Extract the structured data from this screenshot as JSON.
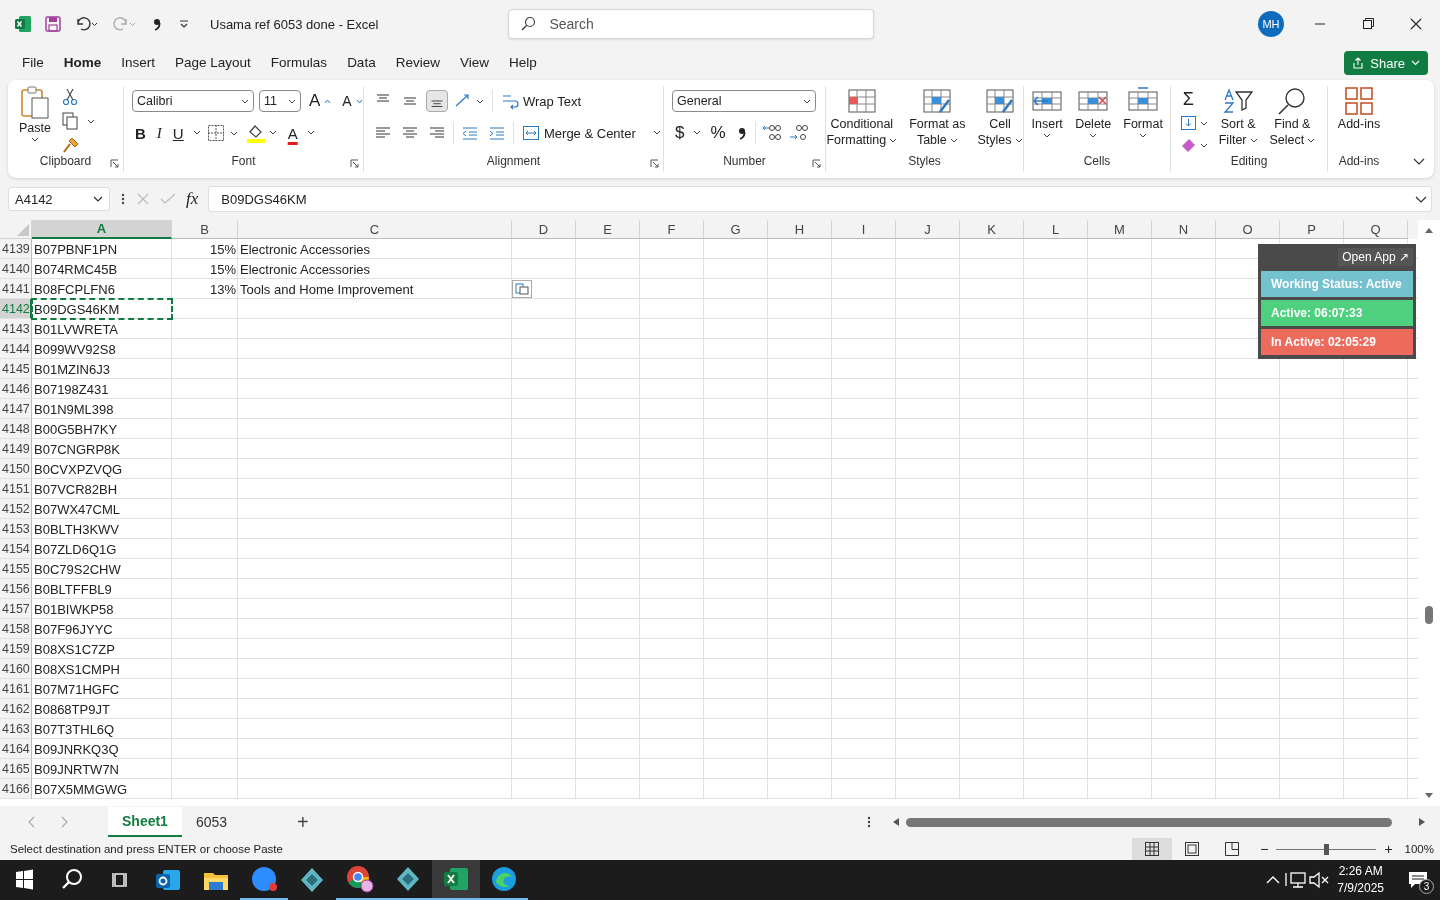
{
  "title_bar": {
    "title": "Usama ref 6053 done - Excel",
    "search": {
      "placeholder": "Search"
    },
    "avatar": "MH"
  },
  "menu_tabs": [
    {
      "label": "File",
      "selected": false
    },
    {
      "label": "Home",
      "selected": true
    },
    {
      "label": "Insert",
      "selected": false
    },
    {
      "label": "Page Layout",
      "selected": false
    },
    {
      "label": "Formulas",
      "selected": false
    },
    {
      "label": "Data",
      "selected": false
    },
    {
      "label": "Review",
      "selected": false
    },
    {
      "label": "View",
      "selected": false
    },
    {
      "label": "Help",
      "selected": false
    }
  ],
  "share_button": "Share",
  "ribbon": {
    "clipboard": {
      "label": "Clipboard",
      "paste": "Paste"
    },
    "font": {
      "label": "Font",
      "family": "Calibri",
      "size": "11",
      "grow": "A",
      "shrink": "A",
      "bold": "B",
      "italic": "I",
      "underline": "U",
      "font_color": "A"
    },
    "alignment": {
      "label": "Alignment",
      "vertical": [
        {
          "selected": false
        },
        {
          "selected": false
        },
        {
          "selected": true
        }
      ],
      "wrap_text": "Wrap Text",
      "merge": "Merge & Center"
    },
    "number": {
      "label": "Number",
      "format": "General",
      "currency": "$",
      "percent": "%"
    },
    "styles": {
      "label": "Styles",
      "buttons": [
        {
          "lines": [
            "Conditional",
            "Formatting"
          ]
        },
        {
          "lines": [
            "Format as",
            "Table"
          ]
        },
        {
          "lines": [
            "Cell",
            "Styles"
          ]
        }
      ]
    },
    "cells": {
      "label": "Cells",
      "buttons": [
        "Insert",
        "Delete",
        "Format"
      ]
    },
    "editing": {
      "label": "Editing",
      "sum": "Σ",
      "buttons": [
        {
          "lines": [
            "Sort &",
            "Filter"
          ]
        },
        {
          "lines": [
            "Find &",
            "Select"
          ]
        }
      ]
    },
    "addins": {
      "label": "Add-ins",
      "button": "Add-ins"
    }
  },
  "formula_bar": {
    "name_box": "A4142",
    "fx": "fx",
    "value": "B09DGS46KM"
  },
  "columns": [
    {
      "label": "A",
      "selected": true
    },
    {
      "label": "B",
      "selected": false
    },
    {
      "label": "C",
      "selected": false
    },
    {
      "label": "D",
      "selected": false
    },
    {
      "label": "E",
      "selected": false
    },
    {
      "label": "F",
      "selected": false
    },
    {
      "label": "G",
      "selected": false
    },
    {
      "label": "H",
      "selected": false
    },
    {
      "label": "I",
      "selected": false
    },
    {
      "label": "J",
      "selected": false
    },
    {
      "label": "K",
      "selected": false
    },
    {
      "label": "L",
      "selected": false
    },
    {
      "label": "M",
      "selected": false
    },
    {
      "label": "N",
      "selected": false
    },
    {
      "label": "O",
      "selected": false
    },
    {
      "label": "P",
      "selected": false
    },
    {
      "label": "Q",
      "selected": false
    }
  ],
  "rows": [
    {
      "number": "4139",
      "a": "B07PBNF1PN",
      "b": "15%",
      "c": "Electronic Accessories",
      "selected": false
    },
    {
      "number": "4140",
      "a": "B074RMC45B",
      "b": "15%",
      "c": "Electronic Accessories",
      "selected": false
    },
    {
      "number": "4141",
      "a": "B08FCPLFN6",
      "b": "13%",
      "c": "Tools and Home Improvement",
      "selected": false,
      "paste_options": true
    },
    {
      "number": "4142",
      "a": "B09DGS46KM",
      "selected": true
    },
    {
      "number": "4143",
      "a": "B01LVWRETA",
      "selected": false
    },
    {
      "number": "4144",
      "a": "B099WV92S8",
      "selected": false
    },
    {
      "number": "4145",
      "a": "B01MZIN6J3",
      "selected": false
    },
    {
      "number": "4146",
      "a": "B07198Z431",
      "selected": false
    },
    {
      "number": "4147",
      "a": "B01N9ML398",
      "selected": false
    },
    {
      "number": "4148",
      "a": "B00G5BH7KY",
      "selected": false
    },
    {
      "number": "4149",
      "a": "B07CNGRP8K",
      "selected": false
    },
    {
      "number": "4150",
      "a": "B0CVXPZVQG",
      "selected": false
    },
    {
      "number": "4151",
      "a": "B07VCR82BH",
      "selected": false
    },
    {
      "number": "4152",
      "a": "B07WX47CML",
      "selected": false
    },
    {
      "number": "4153",
      "a": "B0BLTH3KWV",
      "selected": false
    },
    {
      "number": "4154",
      "a": "B07ZLD6Q1G",
      "selected": false
    },
    {
      "number": "4155",
      "a": "B0C79S2CHW",
      "selected": false
    },
    {
      "number": "4156",
      "a": "B0BLTFFBL9",
      "selected": false
    },
    {
      "number": "4157",
      "a": "B01BIWKP58",
      "selected": false
    },
    {
      "number": "4158",
      "a": "B07F96JYYC",
      "selected": false
    },
    {
      "number": "4159",
      "a": "B08XS1C7ZP",
      "selected": false
    },
    {
      "number": "4160",
      "a": "B08XS1CMPH",
      "selected": false
    },
    {
      "number": "4161",
      "a": "B07M71HGFC",
      "selected": false
    },
    {
      "number": "4162",
      "a": "B0868TP9JT",
      "selected": false
    },
    {
      "number": "4163",
      "a": "B07T3THL6Q",
      "selected": false
    },
    {
      "number": "4164",
      "a": "B09JNRKQ3Q",
      "selected": false
    },
    {
      "number": "4165",
      "a": "B09JNRTW7N",
      "selected": false
    },
    {
      "number": "4166",
      "a": "B07X5MMGWG",
      "selected": false
    }
  ],
  "overlay": {
    "open_app": "Open App ↗",
    "items": [
      {
        "text": "Working Status: Active",
        "color": "#74c2d0"
      },
      {
        "text": "Active: 06:07:33",
        "color": "#4fd07f"
      },
      {
        "text": "In Active: 02:05:29",
        "color": "#ec6b5d"
      }
    ]
  },
  "sheet_tabs": [
    {
      "label": "Sheet1",
      "selected": true
    },
    {
      "label": "6053",
      "selected": false
    }
  ],
  "add_sheet": "+",
  "status_bar": {
    "message": "Select destination and press ENTER or choose Paste",
    "views": [
      {
        "kind": "normal",
        "selected": true
      },
      {
        "kind": "page_layout",
        "selected": false
      },
      {
        "kind": "page_break",
        "selected": false
      }
    ],
    "zoom_out": "−",
    "zoom_in": "+",
    "zoom_slider": {
      "level": 0.5
    },
    "zoom": "100%"
  },
  "taskbar": {
    "apps": [
      {
        "kind": "outlook",
        "running": false,
        "selected": false
      },
      {
        "kind": "explorer",
        "running": false,
        "selected": false
      },
      {
        "kind": "zoom",
        "running": true,
        "selected": false
      },
      {
        "kind": "diamond",
        "running": false,
        "selected": false
      },
      {
        "kind": "chrome",
        "running": true,
        "selected": false
      },
      {
        "kind": "diamond",
        "running": true,
        "selected": false
      },
      {
        "kind": "excel",
        "running": true,
        "selected": true
      },
      {
        "kind": "edge",
        "running": true,
        "selected": false
      }
    ],
    "time": "2:26 AM",
    "date": "7/9/2025",
    "notifications": "3"
  }
}
